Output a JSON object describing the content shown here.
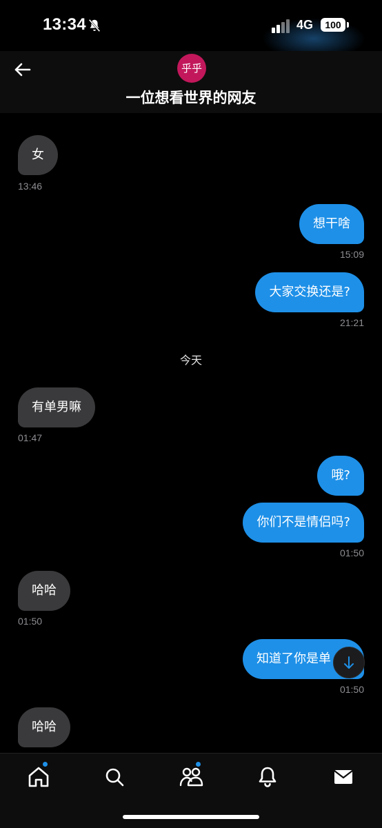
{
  "status_bar": {
    "time": "13:34",
    "network": "4G",
    "battery": "100",
    "icons": [
      "bell-off-icon",
      "signal-icon",
      "battery-icon"
    ]
  },
  "header": {
    "avatar_text": "乎乎",
    "contact_name": "一位想看世界的网友",
    "avatar_color": "#c2185b"
  },
  "messages": [
    {
      "text": "女",
      "time": "13:46",
      "direction": "in"
    },
    {
      "text": "想干啥",
      "time": "15:09",
      "direction": "out"
    },
    {
      "text": "大家交换还是?",
      "time": "21:21",
      "direction": "out"
    },
    {
      "text": "有单男嘛",
      "time": "01:47",
      "direction": "in"
    },
    {
      "text": "哦?",
      "time": "",
      "direction": "out"
    },
    {
      "text": "你们不是情侣吗?",
      "time": "01:50",
      "direction": "out"
    },
    {
      "text": "哈哈",
      "time": "01:50",
      "direction": "in"
    },
    {
      "text": "知道了你是单",
      "time": "01:50",
      "direction": "out"
    },
    {
      "text": "哈哈",
      "time": "",
      "direction": "in"
    }
  ],
  "date_separator": "今天",
  "tab_bar": {
    "tabs": [
      "home-icon",
      "search-icon",
      "community-icon",
      "notifications-icon",
      "messages-icon"
    ],
    "accent_color": "#1e90e8"
  },
  "colors": {
    "outgoing_bubble": "#1e90e8",
    "incoming_bubble": "#3a3a3c",
    "background": "#000000"
  }
}
